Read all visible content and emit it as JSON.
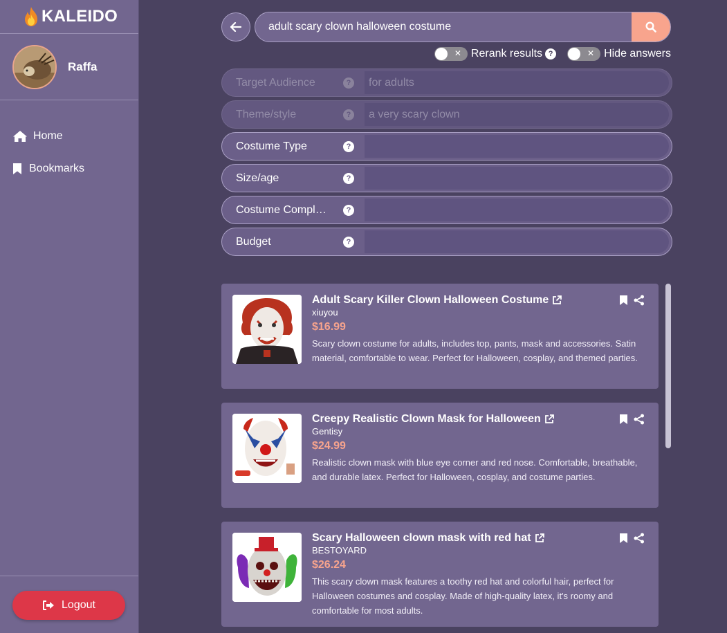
{
  "app": {
    "brand": "KALEIDO"
  },
  "user": {
    "name": "Raffa"
  },
  "sidebar": {
    "items": [
      {
        "label": "Home",
        "icon": "home-icon"
      },
      {
        "label": "Bookmarks",
        "icon": "bookmark-icon"
      }
    ],
    "logout_label": "Logout"
  },
  "search": {
    "value": "adult scary clown halloween costume"
  },
  "options": {
    "rerank_label": "Rerank results",
    "hide_answers_label": "Hide answers"
  },
  "filters": [
    {
      "label": "Target Audience",
      "value": "for adults"
    },
    {
      "label": "Theme/style",
      "value": "a very scary clown"
    },
    {
      "label": "Costume Type",
      "value": ""
    },
    {
      "label": "Size/age",
      "value": ""
    },
    {
      "label": "Costume Complet…",
      "value": ""
    },
    {
      "label": "Budget",
      "value": ""
    }
  ],
  "results": [
    {
      "title": "Adult Scary Killer Clown Halloween Costume",
      "seller": "xiuyou",
      "price": "$16.99",
      "desc": "Scary clown costume for adults, includes top, pants, mask and accessories. Satin material, comfortable to wear. Perfect for Halloween, cosplay, and themed parties."
    },
    {
      "title": "Creepy Realistic Clown Mask for Halloween",
      "seller": "Gentisy",
      "price": "$24.99",
      "desc": "Realistic clown mask with blue eye corner and red nose. Comfortable, breathable, and durable latex. Perfect for Halloween, cosplay, and costume parties."
    },
    {
      "title": "Scary Halloween clown mask with red hat",
      "seller": "BESTOYARD",
      "price": "$26.24",
      "desc": "This scary clown mask features a toothy red hat and colorful hair, perfect for Halloween costumes and cosplay. Made of high-quality latex, it's roomy and comfortable for most adults."
    }
  ],
  "colors": {
    "sidebar": "#72668f",
    "background": "#4a4260",
    "accent": "#f8a48d",
    "logout": "#dd3748"
  }
}
